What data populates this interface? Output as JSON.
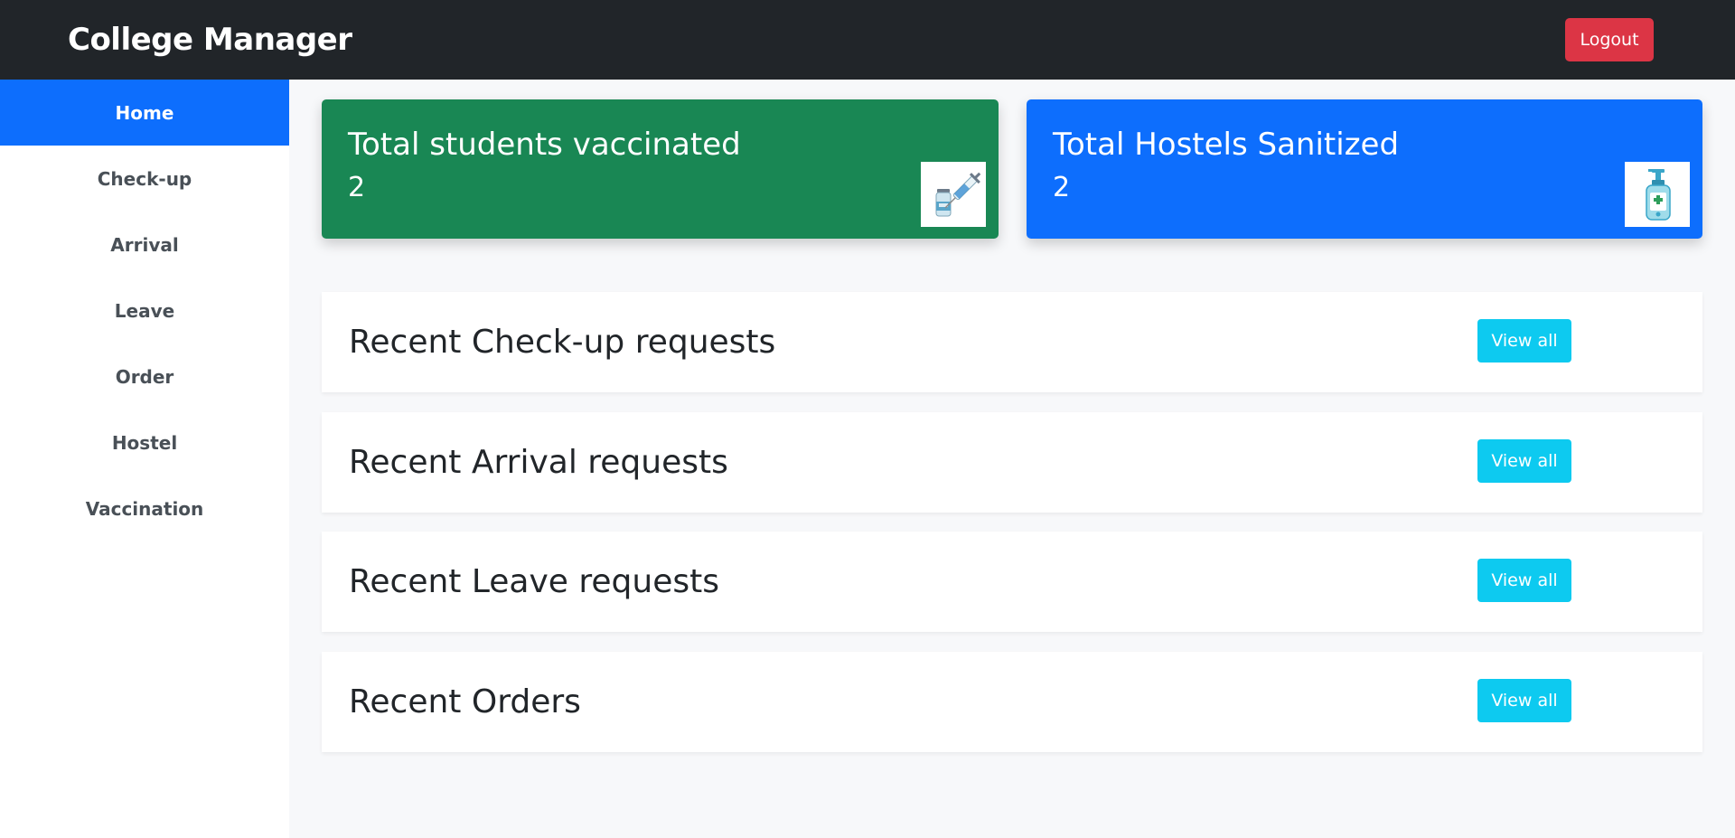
{
  "header": {
    "brand": "College Manager",
    "logout_label": "Logout"
  },
  "sidebar": {
    "items": [
      {
        "label": "Home",
        "active": true
      },
      {
        "label": "Check-up"
      },
      {
        "label": "Arrival"
      },
      {
        "label": "Leave"
      },
      {
        "label": "Order"
      },
      {
        "label": "Hostel"
      },
      {
        "label": "Vaccination"
      }
    ]
  },
  "stats": [
    {
      "title": "Total students vaccinated",
      "value": "2",
      "icon": "vaccine-icon",
      "color": "#198754"
    },
    {
      "title": "Total Hostels Sanitized",
      "value": "2",
      "icon": "sanitizer-icon",
      "color": "#0d6efd"
    }
  ],
  "panels": [
    {
      "title": "Recent Check-up requests",
      "button_label": "View all"
    },
    {
      "title": "Recent Arrival requests",
      "button_label": "View all"
    },
    {
      "title": "Recent Leave requests",
      "button_label": "View all"
    },
    {
      "title": "Recent Orders",
      "button_label": "View all"
    }
  ]
}
